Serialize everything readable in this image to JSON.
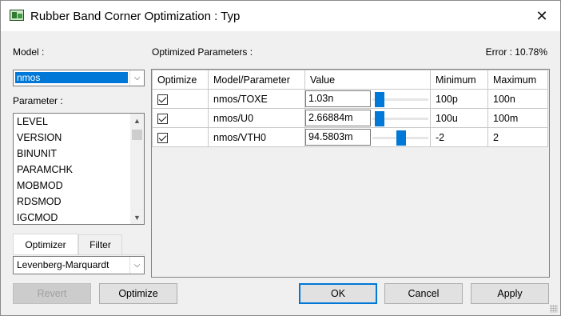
{
  "window": {
    "title": "Rubber Band Corner Optimization : Typ",
    "close_glyph": "✕"
  },
  "model": {
    "label": "Model :",
    "selected": "nmos"
  },
  "parameter": {
    "label": "Parameter :",
    "items": [
      "LEVEL",
      "VERSION",
      "BINUNIT",
      "PARAMCHK",
      "MOBMOD",
      "RDSMOD",
      "IGCMOD"
    ]
  },
  "tabs": [
    {
      "label": "Optimizer",
      "active": true
    },
    {
      "label": "Filter",
      "active": false
    }
  ],
  "optimizer": {
    "selected": "Levenberg-Marquardt"
  },
  "optimized": {
    "label": "Optimized Parameters :",
    "error_text": "Error : 10.78%",
    "columns": [
      "Optimize",
      "Model/Parameter",
      "Value",
      "Minimum",
      "Maximum"
    ],
    "rows": [
      {
        "checked": true,
        "param": "nmos/TOXE",
        "value": "1.03n",
        "slider_level": 0.05,
        "min": "100p",
        "max": "100n"
      },
      {
        "checked": true,
        "param": "nmos/U0",
        "value": "2.66884m",
        "slider_level": 0.05,
        "min": "100u",
        "max": "100m"
      },
      {
        "checked": true,
        "param": "nmos/VTH0",
        "value": "94.5803m",
        "slider_level": 0.52,
        "min": "-2",
        "max": "2"
      }
    ]
  },
  "buttons": {
    "revert": "Revert",
    "optimize": "Optimize",
    "ok": "OK",
    "cancel": "Cancel",
    "apply": "Apply"
  },
  "icons": {
    "app": "circuit-board-icon",
    "close": "close-icon",
    "dropdown": "chevron-down-icon",
    "scroll_up": "chevron-up-icon",
    "scroll_down": "chevron-down-icon"
  },
  "colors": {
    "selection": "#0078d7",
    "slider": "#0078d7",
    "window_bg": "#f0f0f0"
  }
}
